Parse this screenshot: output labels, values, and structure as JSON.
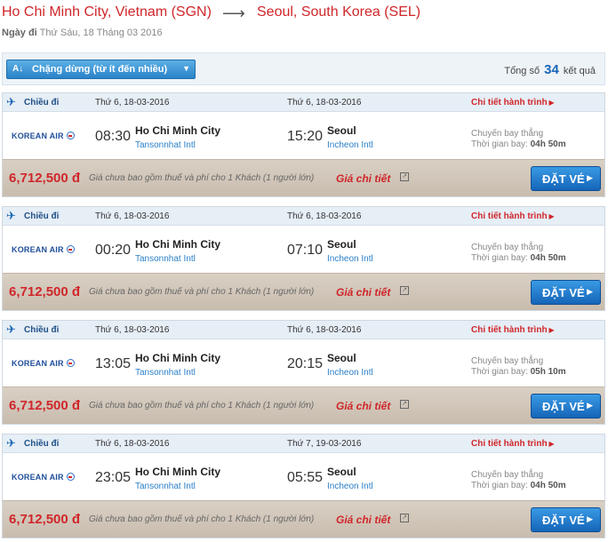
{
  "header": {
    "from": "Ho Chi Minh City, Vietnam (SGN)",
    "to": "Seoul, South Korea (SEL)",
    "arrow": "⟶",
    "date_label": "Ngày đi",
    "date_value": "Thứ Sáu, 18 Tháng 03 2016"
  },
  "toolbar": {
    "sort_icon": "A↓",
    "sort_label": "Chặng dừng (từ ít đến nhiều)",
    "total_prefix": "Tổng số",
    "total_count": "34",
    "total_suffix": "kết quả"
  },
  "common": {
    "direction": "Chiều đi",
    "detail_link": "Chi tiết hành trình",
    "airline": "KOREAN AIR",
    "dep_city": "Ho Chi Minh City",
    "dep_airport": "Tansonnhat Intl",
    "arr_city": "Seoul",
    "arr_airport": "Incheon Intl",
    "flight_type": "Chuyến bay thẳng",
    "duration_label": "Thời gian bay:",
    "price_note": "Giá chưa bao gồm thuế và phí cho 1 Khách (1 người lớn)",
    "price_detail": "Giá chi tiết",
    "book_label": "ĐẶT VÉ"
  },
  "flights": [
    {
      "dep_date": "Thứ 6, 18-03-2016",
      "arr_date": "Thứ 6, 18-03-2016",
      "dep_time": "08:30",
      "arr_time": "15:20",
      "duration": "04h 50m",
      "price": "6,712,500 đ"
    },
    {
      "dep_date": "Thứ 6, 18-03-2016",
      "arr_date": "Thứ 6, 18-03-2016",
      "dep_time": "00:20",
      "arr_time": "07:10",
      "duration": "04h 50m",
      "price": "6,712,500 đ"
    },
    {
      "dep_date": "Thứ 6, 18-03-2016",
      "arr_date": "Thứ 6, 18-03-2016",
      "dep_time": "13:05",
      "arr_time": "20:15",
      "duration": "05h 10m",
      "price": "6,712,500 đ"
    },
    {
      "dep_date": "Thứ 6, 18-03-2016",
      "arr_date": "Thứ 7, 19-03-2016",
      "dep_time": "23:05",
      "arr_time": "05:55",
      "duration": "04h 50m",
      "price": "6,712,500 đ"
    }
  ],
  "icons": {
    "plane": "plane-icon",
    "sort": "sort-icon",
    "chevron": "chevron-down-icon",
    "external": "external-link-icon"
  },
  "colors": {
    "accent_red": "#d0262a",
    "brand_blue": "#1a66b5",
    "button_blue": "#2a82c8"
  }
}
